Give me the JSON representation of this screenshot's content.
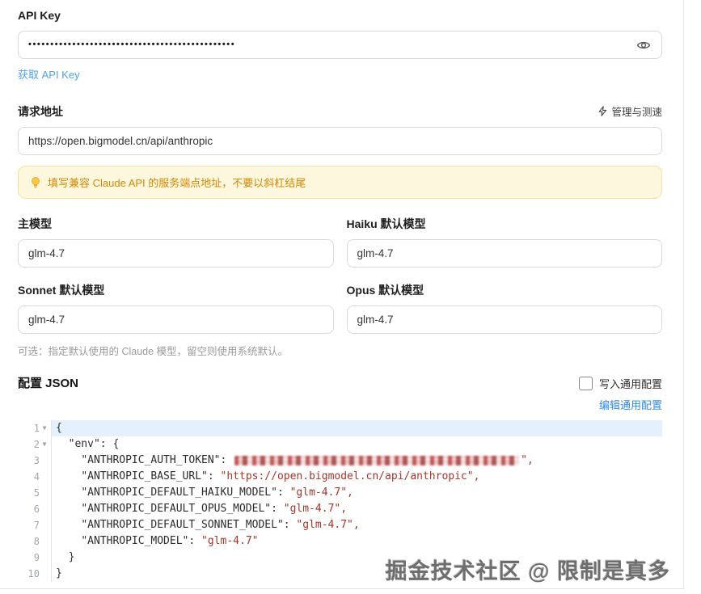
{
  "api_key_section": {
    "label": "API Key",
    "masked_value": "•••••••••••••••••••••••••••••••••••••••••••••••",
    "get_key_link": "获取 API Key"
  },
  "endpoint_section": {
    "label": "请求地址",
    "manage_link": "管理与测速",
    "url_value": "https://open.bigmodel.cn/api/anthropic",
    "warning_text": "填写兼容 Claude API 的服务端点地址，不要以斜杠结尾"
  },
  "models": {
    "fields": [
      {
        "label": "主模型",
        "value": "glm-4.7"
      },
      {
        "label": "Haiku 默认模型",
        "value": "glm-4.7"
      },
      {
        "label": "Sonnet 默认模型",
        "value": "glm-4.7"
      },
      {
        "label": "Opus 默认模型",
        "value": "glm-4.7"
      }
    ],
    "note": "可选：指定默认使用的 Claude 模型，留空则使用系统默认。"
  },
  "config_json": {
    "title": "配置 JSON",
    "write_common_label": "写入通用配置",
    "write_common_checked": false,
    "edit_common_link": "编辑通用配置",
    "editor_lines": [
      {
        "n": "1",
        "fold": true,
        "active": true,
        "segs": [
          {
            "c": "plain",
            "t": "{"
          }
        ]
      },
      {
        "n": "2",
        "fold": true,
        "segs": [
          {
            "c": "plain",
            "t": "  "
          },
          {
            "c": "key",
            "t": "\"env\""
          },
          {
            "c": "plain",
            "t": ": {"
          }
        ]
      },
      {
        "n": "3",
        "segs": [
          {
            "c": "plain",
            "t": "    "
          },
          {
            "c": "key",
            "t": "\"ANTHROPIC_AUTH_TOKEN\""
          },
          {
            "c": "plain",
            "t": ": "
          },
          {
            "c": "redacted",
            "t": ""
          },
          {
            "c": "str",
            "t": "\","
          }
        ]
      },
      {
        "n": "4",
        "segs": [
          {
            "c": "plain",
            "t": "    "
          },
          {
            "c": "key",
            "t": "\"ANTHROPIC_BASE_URL\""
          },
          {
            "c": "plain",
            "t": ": "
          },
          {
            "c": "str",
            "t": "\"https://open.bigmodel.cn/api/anthropic\","
          }
        ]
      },
      {
        "n": "5",
        "segs": [
          {
            "c": "plain",
            "t": "    "
          },
          {
            "c": "key",
            "t": "\"ANTHROPIC_DEFAULT_HAIKU_MODEL\""
          },
          {
            "c": "plain",
            "t": ": "
          },
          {
            "c": "str",
            "t": "\"glm-4.7\","
          }
        ]
      },
      {
        "n": "6",
        "segs": [
          {
            "c": "plain",
            "t": "    "
          },
          {
            "c": "key",
            "t": "\"ANTHROPIC_DEFAULT_OPUS_MODEL\""
          },
          {
            "c": "plain",
            "t": ": "
          },
          {
            "c": "str",
            "t": "\"glm-4.7\","
          }
        ]
      },
      {
        "n": "7",
        "segs": [
          {
            "c": "plain",
            "t": "    "
          },
          {
            "c": "key",
            "t": "\"ANTHROPIC_DEFAULT_SONNET_MODEL\""
          },
          {
            "c": "plain",
            "t": ": "
          },
          {
            "c": "str",
            "t": "\"glm-4.7\","
          }
        ]
      },
      {
        "n": "8",
        "segs": [
          {
            "c": "plain",
            "t": "    "
          },
          {
            "c": "key",
            "t": "\"ANTHROPIC_MODEL\""
          },
          {
            "c": "plain",
            "t": ": "
          },
          {
            "c": "str",
            "t": "\"glm-4.7\""
          }
        ]
      },
      {
        "n": "9",
        "segs": [
          {
            "c": "plain",
            "t": "  }"
          }
        ]
      },
      {
        "n": "10",
        "segs": [
          {
            "c": "plain",
            "t": "}"
          }
        ]
      }
    ]
  },
  "watermark": "掘金技术社区 @ 限制是真多",
  "colors": {
    "link_light_blue": "#4da3e3",
    "link_blue": "#2e8be6",
    "warning_bg": "#fdf7dd",
    "warning_border": "#f2e3a1",
    "warning_text": "#d48806",
    "code_string": "#a5342a",
    "active_line_bg": "#e4f0fb"
  }
}
